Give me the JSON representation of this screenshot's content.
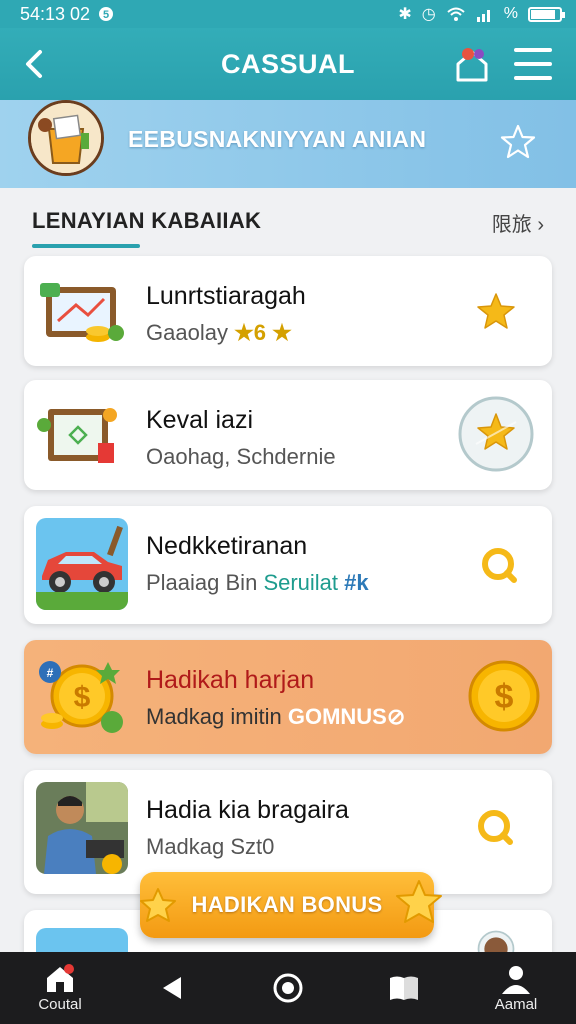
{
  "status_bar": {
    "time": "54:13 02",
    "battery_level": 0.85
  },
  "app_bar": {
    "title": "CASSUAL"
  },
  "banner": {
    "text": "EEBUSNAKNIYYAN ANIAN"
  },
  "section": {
    "title": "LENAYIAN KABAIIAK",
    "more_label": "限旅 ›"
  },
  "cards": [
    {
      "title": "Lunrtstiaragah",
      "subtitle": "Gaaolay",
      "subtitle_accent": "★6 ★"
    },
    {
      "title": "Keval iazi",
      "subtitle": "Oaohag, Schdernie",
      "subtitle_accent": ""
    },
    {
      "title": "Nedkketiranan",
      "subtitle": "Plaaiag Bin",
      "subtitle_accent": "Seruilat",
      "subtitle_accent2": "#k"
    },
    {
      "title": "Hadikah harjan",
      "subtitle": "Madkag imitin",
      "subtitle_accent": "GOMNUS⊘"
    },
    {
      "title": "Hadia kia bragaira",
      "subtitle": "Madkag Szt0",
      "subtitle_accent": ""
    }
  ],
  "bonus_button": {
    "label": "HADIKAN BONUS"
  },
  "nav": [
    {
      "label": "Coutal",
      "icon": "home-icon"
    },
    {
      "label": "",
      "icon": "back-triangle-icon"
    },
    {
      "label": "",
      "icon": "circle-home-icon"
    },
    {
      "label": "",
      "icon": "book-icon"
    },
    {
      "label": "Aamal",
      "icon": "person-icon"
    }
  ],
  "colors": {
    "primary": "#2aa1ae",
    "accent": "#f39a12",
    "highlight_card": "#f2a871"
  }
}
